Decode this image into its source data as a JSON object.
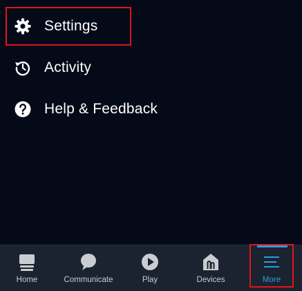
{
  "menu": {
    "items": [
      {
        "label": "Settings",
        "icon": "gear-icon"
      },
      {
        "label": "Activity",
        "icon": "history-icon"
      },
      {
        "label": "Help & Feedback",
        "icon": "help-icon"
      }
    ]
  },
  "bottom_nav": {
    "items": [
      {
        "label": "Home",
        "icon": "home-icon"
      },
      {
        "label": "Communicate",
        "icon": "chat-bubble-icon"
      },
      {
        "label": "Play",
        "icon": "play-icon"
      },
      {
        "label": "Devices",
        "icon": "devices-house-icon"
      },
      {
        "label": "More",
        "icon": "menu-lines-icon",
        "active": true
      }
    ]
  },
  "annotations": {
    "highlight_color": "#e3141b",
    "highlighted": [
      "Settings",
      "More"
    ]
  },
  "colors": {
    "background": "#050a18",
    "nav_background": "#1b2230",
    "accent": "#2d9cdb"
  }
}
